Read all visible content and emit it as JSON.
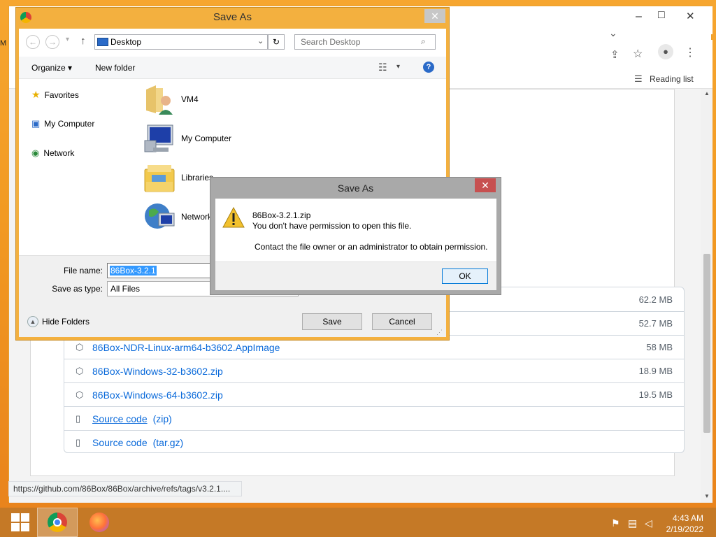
{
  "browser": {
    "menu_fragment": "M",
    "window_controls": {
      "minimize": "–",
      "maximize": "□",
      "close": "✕"
    },
    "reading_list_label": "Reading list",
    "status_url": "https://github.com/86Box/86Box/archive/refs/tags/v3.2.1...."
  },
  "assets": [
    {
      "name": "",
      "size": "62.2 MB",
      "icon": "package-icon"
    },
    {
      "name": "",
      "size": "52.7 MB",
      "icon": "package-icon"
    },
    {
      "name": "86Box-NDR-Linux-arm64-b3602.AppImage",
      "size": "58 MB",
      "icon": "package-icon"
    },
    {
      "name": "86Box-Windows-32-b3602.zip",
      "size": "18.9 MB",
      "icon": "package-icon"
    },
    {
      "name": "86Box-Windows-64-b3602.zip",
      "size": "19.5 MB",
      "icon": "package-icon"
    },
    {
      "name": "Source code",
      "suffix": "(zip)",
      "size": "",
      "icon": "file-zip-icon"
    },
    {
      "name": "Source code",
      "suffix": "(tar.gz)",
      "size": "",
      "icon": "file-zip-icon"
    }
  ],
  "save_dialog": {
    "title": "Save As",
    "location": "Desktop",
    "search_placeholder": "Search Desktop",
    "toolbar": {
      "organize": "Organize ▾",
      "new_folder": "New folder"
    },
    "nav_items": [
      {
        "label": "Favorites",
        "icon": "star-icon"
      },
      {
        "label": "My Computer",
        "icon": "computer-icon"
      },
      {
        "label": "Network",
        "icon": "network-icon"
      }
    ],
    "files": [
      {
        "label": "VM4",
        "icon": "user-folder-icon"
      },
      {
        "label": "My Computer",
        "icon": "computer-icon"
      },
      {
        "label": "Libraries",
        "icon": "libraries-icon"
      },
      {
        "label": "Network",
        "icon": "network-icon"
      }
    ],
    "file_name_label": "File name:",
    "file_name_value": "86Box-3.2.1",
    "save_type_label": "Save as type:",
    "save_type_value": "All Files",
    "hide_folders": "Hide Folders",
    "save_button": "Save",
    "cancel_button": "Cancel"
  },
  "error_dialog": {
    "title": "Save As",
    "filename": "86Box-3.2.1.zip",
    "message": "You don't have permission to open this file.",
    "detail": "Contact the file owner or an administrator to obtain permission.",
    "ok_button": "OK"
  },
  "taskbar": {
    "time": "4:43 AM",
    "date": "2/19/2022"
  },
  "colors": {
    "link": "#0969da",
    "title_active": "#f3b03f",
    "selection": "#3399ff"
  }
}
